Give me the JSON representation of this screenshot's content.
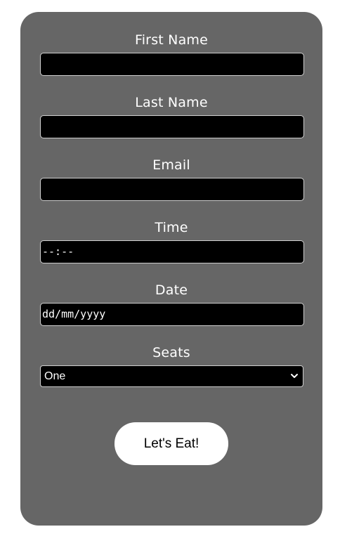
{
  "form": {
    "fields": [
      {
        "label": "First Name",
        "value": ""
      },
      {
        "label": "Last Name",
        "value": ""
      },
      {
        "label": "Email",
        "value": ""
      },
      {
        "label": "Time",
        "value": "--:--"
      },
      {
        "label": "Date",
        "value": "dd/mm/yyyy"
      }
    ],
    "seats": {
      "label": "Seats",
      "selected": "One"
    },
    "submit_label": "Let's Eat!"
  },
  "colors": {
    "card_background": "#666666",
    "input_background": "#000000",
    "text": "#ffffff",
    "button_background": "#ffffff"
  },
  "icons": {
    "select_arrow": "chevron-down-icon"
  }
}
